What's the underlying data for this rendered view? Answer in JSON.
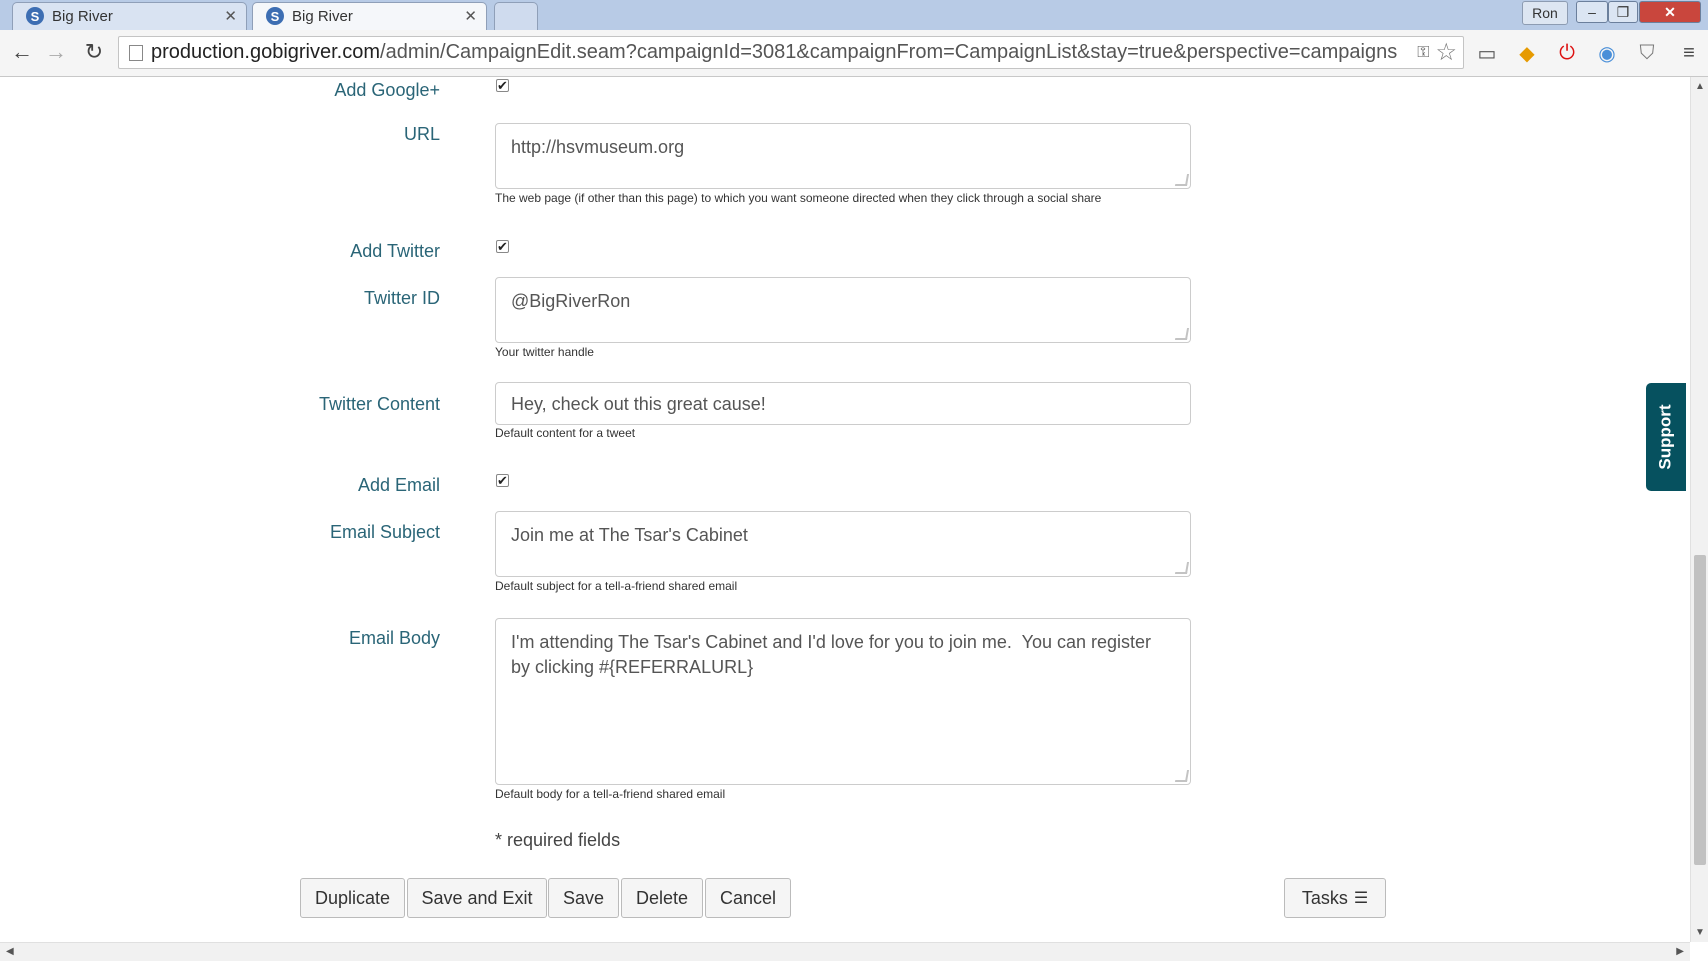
{
  "browser": {
    "tabs": [
      {
        "title": "Big River",
        "active": false
      },
      {
        "title": "Big River",
        "active": true
      }
    ],
    "user_badge": "Ron",
    "url_host": "production.gobigriver.com",
    "url_path": "/admin/CampaignEdit.seam?campaignId=3081&campaignFrom=CampaignList&stay=true&perspective=campaigns"
  },
  "form": {
    "add_google_label": "Add Google+",
    "url_label": "URL",
    "url_value": "http://hsvmuseum.org",
    "url_help": "The web page (if other than this page) to which you want someone directed when they click through a social share",
    "add_twitter_label": "Add Twitter",
    "twitter_id_label": "Twitter ID",
    "twitter_id_value": "@BigRiverRon",
    "twitter_id_help": "Your twitter handle",
    "twitter_content_label": "Twitter Content",
    "twitter_content_value": "Hey, check out this great cause!",
    "twitter_content_help": "Default content for a tweet",
    "add_email_label": "Add Email",
    "email_subject_label": "Email Subject",
    "email_subject_value": "Join me at The Tsar's Cabinet",
    "email_subject_help": "Default subject for a tell-a-friend shared email",
    "email_body_label": "Email Body",
    "email_body_value": "I'm attending The Tsar's Cabinet and I'd love for you to join me.  You can register by clicking #{REFERRALURL}",
    "email_body_help": "Default body for a tell-a-friend shared email",
    "required_note": "* required fields"
  },
  "buttons": {
    "duplicate": "Duplicate",
    "save_exit": "Save and Exit",
    "save": "Save",
    "delete": "Delete",
    "cancel": "Cancel",
    "tasks": "Tasks"
  },
  "support_tab": "Support",
  "checkmark": "✔"
}
